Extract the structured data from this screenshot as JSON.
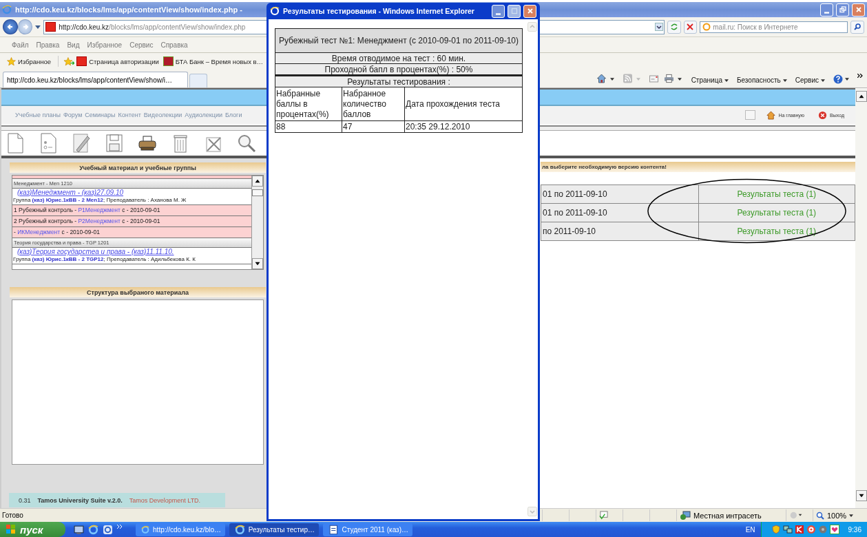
{
  "browser": {
    "title": "http://cdo.keu.kz/blocks/lms/app/contentView/show/index.php -",
    "address_host": "http://cdo.keu.kz",
    "address_path": "/blocks/lms/app/contentView/show/index.php",
    "search_placeholder": "mail.ru: Поиск в Интернете",
    "menu": [
      "Файл",
      "Правка",
      "Вид",
      "Избранное",
      "Сервис",
      "Справка"
    ],
    "favorites_label": "Избранное",
    "favorite_links": [
      "Страница авторизации",
      "БТА Банк – Время новых в…"
    ],
    "tabs": [
      {
        "label": "http://cdo.keu.kz/blocks/lms/app/contentView/show/i…",
        "selected": true
      }
    ],
    "command_bar": [
      "Страница",
      "Безопасность",
      "Сервис"
    ],
    "status": "Готово",
    "zone": "Местная интрасеть",
    "zoom": "100%"
  },
  "page": {
    "nav": [
      "Учебные планы",
      "Форум",
      "Семинары",
      "Контент",
      "Видеолекции",
      "Аудиолекции",
      "Блоги"
    ],
    "top_links": [
      "На главную",
      "Выход"
    ],
    "materials_panel": {
      "title": "Учебный материал и учебные группы",
      "items": [
        {
          "kind": "partial"
        },
        {
          "kind": "group",
          "text": "Менеджмент - Men 1210"
        },
        {
          "kind": "course",
          "link": "(каз)Менеджмент - (каз)27.09.10",
          "info": "Группа **(каз) Юрис.1кВВ - 2 Men12**; Преподаватель : Аханова М. Ж"
        },
        {
          "kind": "control",
          "prefix": "1 Рубежный контроль -",
          "link": "P1Менеджмент",
          "suffix": "с - 2010-09-01"
        },
        {
          "kind": "control",
          "prefix": "2 Рубежный контроль -",
          "link": "P2Менеджмент",
          "suffix": "с - 2010-09-01"
        },
        {
          "kind": "control",
          "prefix": "-",
          "link": "ИКМенеджмент",
          "suffix": "с - 2010-09-01"
        },
        {
          "kind": "group",
          "text": "Теория государства и права - TGP 1201"
        },
        {
          "kind": "course",
          "link": "(каз)Теория государстеа и права - (каз)11.11.10.",
          "info": "Группа **(каз) Юрис.1кВВ - 2 TGP12**; Преподаватель : Адильбекова К. К"
        }
      ]
    },
    "structure_panel": {
      "title": "Структура выбраного материала"
    },
    "footer": {
      "version": "0.31",
      "product": "Tamos University Suite v.2.0.",
      "company": "Tamos Development LTD."
    },
    "notice": "ла выберите необходимую версию контента!",
    "versions": [
      {
        "period": "01 по 2011-09-10",
        "result": "Результаты теста (1)"
      },
      {
        "period": "01 по 2011-09-10",
        "result": "Результаты теста (1)"
      },
      {
        "period": "по 2011-09-10",
        "result": "Результаты теста (1)"
      }
    ]
  },
  "popup": {
    "title": "Результаты тестирования - Windows Internet Explorer",
    "test_title": "Рубежный тест №1: Менеджмент (с 2010-09-01 по 2011-09-10)",
    "time": "Время отводимое на тест : 60 мин.",
    "pass": "Проходной бапл в процентах(%) : 50%",
    "results_title": "Результаты тестирования :",
    "columns": [
      "Набранные баллы в процентах(%)",
      "Набранное количество баллов",
      "Дата прохождения теста"
    ],
    "rows": [
      [
        "88",
        "47",
        "20:35 29.12.2010"
      ]
    ]
  },
  "taskbar": {
    "start": "пуск",
    "tasks": [
      {
        "label": "http://cdo.keu.kz/blo…",
        "selected": false
      },
      {
        "label": "Результаты тестир…",
        "selected": true
      },
      {
        "label": "Студент 2011 (каз)…",
        "selected": false
      }
    ],
    "language": "EN",
    "clock": "9:36"
  }
}
